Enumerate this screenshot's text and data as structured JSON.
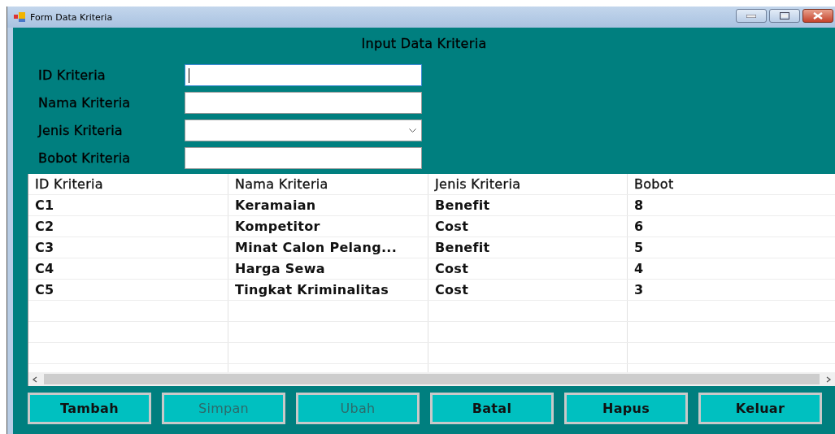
{
  "window": {
    "title": "Form Data Kriteria"
  },
  "heading": "Input Data Kriteria",
  "fields": [
    {
      "kind": "text",
      "label": "ID Kriteria",
      "focused": true
    },
    {
      "kind": "text",
      "label": "Nama Kriteria",
      "focused": false
    },
    {
      "kind": "dropdown",
      "label": "Jenis Kriteria",
      "focused": false
    },
    {
      "kind": "text",
      "label": "Bobot Kriteria",
      "focused": false
    }
  ],
  "table": {
    "columns": [
      "ID Kriteria",
      "Nama Kriteria",
      "Jenis Kriteria",
      "Bobot"
    ],
    "rows": [
      [
        "C1",
        "Keramaian",
        "Benefit",
        "8"
      ],
      [
        "C2",
        "Kompetitor",
        "Cost",
        "6"
      ],
      [
        "C3",
        "Minat Calon Pelang...",
        "Benefit",
        "5"
      ],
      [
        "C4",
        "Harga Sewa",
        "Cost",
        "4"
      ],
      [
        "C5",
        "Tingkat Kriminalitas",
        "Cost",
        "3"
      ]
    ]
  },
  "buttons": [
    {
      "label": "Tambah",
      "disabled": false
    },
    {
      "label": "Simpan",
      "disabled": true
    },
    {
      "label": "Ubah",
      "disabled": true
    },
    {
      "label": "Batal",
      "disabled": false
    },
    {
      "label": "Hapus",
      "disabled": false
    },
    {
      "label": "Keluar",
      "disabled": false
    }
  ]
}
